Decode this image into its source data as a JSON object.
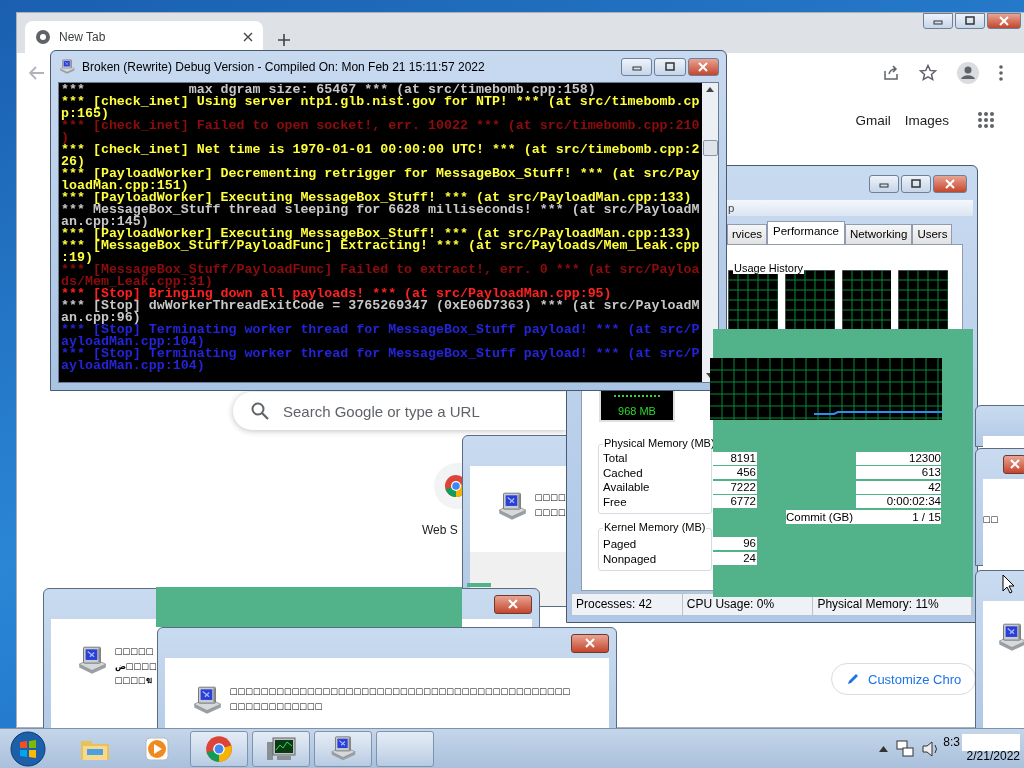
{
  "browser": {
    "tab": {
      "title": "New Tab",
      "selected": true
    },
    "links": [
      "Gmail",
      "Images"
    ],
    "search": {
      "placeholder": "Search Google or type a URL"
    },
    "shortcut": {
      "label": "Web S"
    },
    "customize_button": "Customize Chro"
  },
  "console": {
    "title": "Broken (Rewrite) Debug Version - Compiled On: Mon Feb 21 15:11:57 2022",
    "lines": [
      {
        "text": "***             max dgram size: 65467 *** (at src/timebomb.cpp:158)",
        "kind": "info"
      },
      {
        "text": "*** [check_inet] Using server ntp1.glb.nist.gov for NTP! *** (at src/timebomb.cp",
        "kind": "notice"
      },
      {
        "text": "p:165)",
        "kind": "notice"
      },
      {
        "text": "*** [check_inet] Failed to open socket!, err. 10022 *** (at src/timebomb.cpp:210",
        "kind": "fault"
      },
      {
        "text": ")",
        "kind": "fault"
      },
      {
        "text": "*** [check_inet] Net time is 1970-01-01 00:00:00 UTC! *** (at src/timebomb.cpp:2",
        "kind": "notice"
      },
      {
        "text": "26)",
        "kind": "notice"
      },
      {
        "text": "*** [PayloadWorker] Decrementing retrigger for MessageBox_Stuff! *** (at src/Pay",
        "kind": "notice"
      },
      {
        "text": "loadMan.cpp:151)",
        "kind": "notice"
      },
      {
        "text": "*** [PayloadWorker] Executing MessageBox_Stuff! *** (at src/PayloadMan.cpp:133)",
        "kind": "notice"
      },
      {
        "text": "*** MessageBox_Stuff thread sleeping for 6628 milliseconds! *** (at src/PayloadM",
        "kind": "info"
      },
      {
        "text": "an.cpp:145)",
        "kind": "info"
      },
      {
        "text": "*** [PayloadWorker] Executing MessageBox_Stuff! *** (at src/PayloadMan.cpp:133)",
        "kind": "notice"
      },
      {
        "text": "*** [MessageBox_Stuff/PayloadFunc] Extracting! *** (at src/Payloads/Mem_Leak.cpp",
        "kind": "notice"
      },
      {
        "text": ":19)",
        "kind": "notice"
      },
      {
        "text": "*** [MessageBox_Stuff/PayloadFunc] Failed to extract!, err. 0 *** (at src/Payloa",
        "kind": "fault"
      },
      {
        "text": "ds/Mem_Leak.cpp:31)",
        "kind": "fault"
      },
      {
        "text": "*** [Stop] Bringing down all payloads! *** (at src/PayloadMan.cpp:95)",
        "kind": "alert"
      },
      {
        "text": "*** [Stop] dwWorkerThreadExitCode = 3765269347 (0xE06D7363) *** (at src/PayloadM",
        "kind": "info"
      },
      {
        "text": "an.cpp:96)",
        "kind": "info"
      },
      {
        "text": "*** [Stop] Terminating worker thread for MessageBox_Stuff payload! *** (at src/P",
        "kind": "stop"
      },
      {
        "text": "ayloadMan.cpp:104)",
        "kind": "stop"
      },
      {
        "text": "*** [Stop] Terminating worker thread for MessageBox_Stuff payload! *** (at src/P",
        "kind": "stop"
      },
      {
        "text": "ayloadMan.cpp:104)",
        "kind": "stop"
      }
    ]
  },
  "task_manager": {
    "menu_fragment": "p",
    "tabs": [
      {
        "label": "rvices",
        "selected": false
      },
      {
        "label": "Performance",
        "selected": true
      },
      {
        "label": "Networking",
        "selected": false
      },
      {
        "label": "Users",
        "selected": false
      }
    ],
    "usage_group": "Usage History",
    "memory_meter": "968 MB",
    "physical_memory": {
      "title": "Physical Memory (MB)",
      "rows": [
        {
          "label": "Total",
          "value": "8191"
        },
        {
          "label": "Cached",
          "value": "456"
        },
        {
          "label": "Available",
          "value": "7222"
        },
        {
          "label": "Free",
          "value": "6772"
        }
      ]
    },
    "system_values": [
      "12300",
      "613",
      "42",
      "0:00:02:34"
    ],
    "commit": {
      "label": "Commit (GB)",
      "value": "1 / 15"
    },
    "kernel_memory": {
      "title": "Kernel Memory (MB)",
      "rows": [
        {
          "label": "Paged",
          "value": "96"
        },
        {
          "label": "Nonpaged",
          "value": "24"
        }
      ]
    },
    "status_bar": [
      "Processes: 42",
      "CPU Usage: 0%",
      "Physical Memory: 11%"
    ]
  },
  "message_boxes": [
    {
      "kind": "middle",
      "lines": [
        "□□□□",
        "□□□□"
      ]
    },
    {
      "kind": "left",
      "lines": [
        "□□□□□",
        "ض□□□□",
        "□□□□ฆ"
      ]
    },
    {
      "kind": "bottom",
      "lines": [
        "□□□□□□□□□□□□□□□□□□□□□□□□□□□□□□□□□□□□□□□□□□□□□□□□□□□□□□□□"
      ]
    },
    {
      "kind": "edge-top"
    },
    {
      "kind": "edge-middle",
      "lines": [
        "□□"
      ]
    },
    {
      "kind": "edge-bottom"
    }
  ],
  "taskbar": {
    "buttons": [
      {
        "kind": "explorer",
        "running": false
      },
      {
        "kind": "media",
        "running": false
      },
      {
        "kind": "chrome",
        "running": true
      },
      {
        "kind": "monitor",
        "running": true
      },
      {
        "kind": "computer",
        "running": true
      },
      {
        "kind": "blank",
        "running": true
      }
    ],
    "clock": {
      "time": "8:3",
      "date": "2/21/2022"
    }
  }
}
